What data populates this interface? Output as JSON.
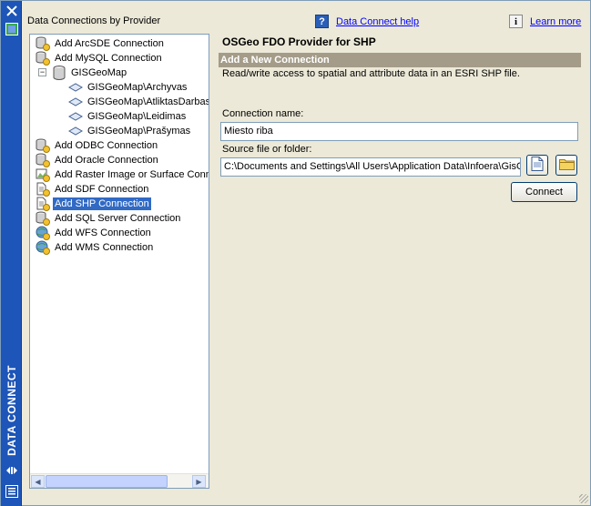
{
  "palette": {
    "title": "DATA CONNECT",
    "close_icon": "close-icon",
    "properties_icon": "properties-icon",
    "autohide_icon": "autohide-icon",
    "menu_icon": "menu-icon",
    "color": "#1d55b8"
  },
  "tree": {
    "heading": "Data Connections by Provider",
    "items": [
      {
        "label": "Add ArcSDE Connection",
        "icon": "database-add-icon"
      },
      {
        "label": "Add MySQL Connection",
        "icon": "database-add-icon"
      },
      {
        "label": "GISGeoMap",
        "icon": "database-icon",
        "expander": "−"
      },
      {
        "label": "GISGeoMap\\Archyvas",
        "icon": "schema-icon"
      },
      {
        "label": "GISGeoMap\\AtliktasDarbas",
        "icon": "schema-icon"
      },
      {
        "label": "GISGeoMap\\Leidimas",
        "icon": "schema-icon"
      },
      {
        "label": "GISGeoMap\\Prašymas",
        "icon": "schema-icon"
      },
      {
        "label": "Add ODBC Connection",
        "icon": "database-add-icon"
      },
      {
        "label": "Add Oracle Connection",
        "icon": "database-add-icon"
      },
      {
        "label": "Add Raster Image or Surface Connection",
        "icon": "raster-add-icon"
      },
      {
        "label": "Add SDF Connection",
        "icon": "file-add-icon"
      },
      {
        "label": "Add SHP Connection",
        "icon": "file-add-icon",
        "selected": true
      },
      {
        "label": "Add SQL Server Connection",
        "icon": "database-add-icon"
      },
      {
        "label": "Add WFS Connection",
        "icon": "globe-add-icon"
      },
      {
        "label": "Add WMS Connection",
        "icon": "globe-add-icon"
      }
    ]
  },
  "help": {
    "data_connect_help": "Data Connect help",
    "learn_more": "Learn more"
  },
  "main": {
    "provider_title": "OSGeo FDO Provider for SHP",
    "section_title": "Add a New Connection",
    "description": "Read/write access to spatial and attribute data in an ESRI SHP file.",
    "connection_name_label": "Connection name:",
    "connection_name_value": "Miesto riba",
    "source_label": "Source file or folder:",
    "source_value": "C:\\Documents and Settings\\All Users\\Application Data\\Infoera\\GisG",
    "connect_label": "Connect"
  },
  "colors": {
    "selection": "#316ac5",
    "section_bar": "#a49c89",
    "link": "#0000ff"
  }
}
